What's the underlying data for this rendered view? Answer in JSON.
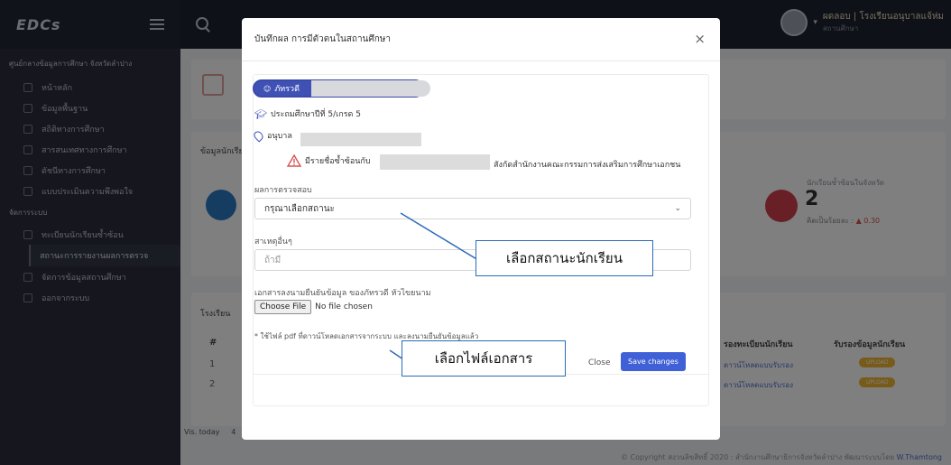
{
  "topbar": {
    "brand": "EDCs",
    "user_name": "ผดลอบ | โรงเรียนอนุบาลแจ้ห่ม",
    "user_role": "สถานศึกษา"
  },
  "sidebar": {
    "org": "ศูนย์กลางข้อมูลการศึกษา จังหวัดลำปาง",
    "items": [
      {
        "label": "หน้าหลัก"
      },
      {
        "label": "ข้อมูลพื้นฐาน"
      },
      {
        "label": "สถิติทางการศึกษา"
      },
      {
        "label": "สารสนเทศทางการศึกษา"
      },
      {
        "label": "ดัชนีทางการศึกษา"
      },
      {
        "label": "แบบประเมินความพึงพอใจ"
      }
    ],
    "section": "จัดการระบบ",
    "items2": [
      {
        "label": "ทะเบียนนักเรียนซ้ำซ้อน"
      }
    ],
    "subitem": "สถานะการรายงานผลการตรวจ",
    "items3": [
      {
        "label": "จัดการข้อมูลสถานศึกษา"
      },
      {
        "label": "ออกจากระบบ"
      }
    ]
  },
  "dashboard": {
    "card_label": "ข้อมูลนักเรียน",
    "stat_label": "นักเรียนซ้ำซ้อนในจังหวัด",
    "stat_value": "2",
    "stat_pct_label": "คิดเป็นร้อยละ :",
    "stat_pct_value": "▲ 0.30",
    "table_label": "โรงเรียน",
    "col_hash": "#",
    "col_reg": "รองทะเบียนนักเรียน",
    "col_cert": "รับรองข้อมูลนักเรียน",
    "rows": [
      {
        "n": "1",
        "link": "ดาวน์โหลดแบบรับรอง",
        "btn": "UPLOAD"
      },
      {
        "n": "2",
        "link": "ดาวน์โหลดแบบรับรอง",
        "btn": "UPLOAD"
      }
    ],
    "footer_left_label": "Vis. today",
    "footer_left_value": "4",
    "footer_right": "© Copyright สงวนลิขสิทธิ์ 2020 : สำนักงานศึกษาธิการจังหวัดลำปาง พัฒนาระบบโดย",
    "footer_right_link": "W.Thamtong"
  },
  "modal": {
    "title": "บันทึกผล การมีตัวตนในสถานศึกษา",
    "close_glyph": "×",
    "student_prefix": "ภัทรวดี",
    "grade": "ประถมศึกษาปีที่ 5/เกรด 5",
    "school_prefix": "อนุบาล",
    "warning_prefix": "มีรายชื่อซ้ำซ้อนกับ",
    "warning_suffix": "สังกัดสำนักงานคณะกรรมการส่งเสริมการศึกษาเอกชน",
    "result_label": "ผลการตรวจสอบ",
    "result_placeholder": "กรุณาเลือกสถานะ",
    "reason_label": "สาเหตุอื่นๆ",
    "reason_placeholder": "ถ้ามี",
    "file_label": "เอกสารลงนามยืนยันข้อมูล ของภัทรวดี หัวไขยนาม",
    "file_button": "Choose File",
    "file_status": "No file chosen",
    "note": "* ใช้ไฟล์ pdf ที่ดาวน์โหลดเอกสารจากระบบ และลงนามยืนยันข้อมูลแล้ว",
    "close_button": "Close",
    "save_button": "Save changes"
  },
  "callouts": {
    "status": "เลือกสถานะนักเรียน",
    "file": "เลือกไฟล์เอกสาร"
  },
  "colors": {
    "accent": "#3f51b5",
    "save": "#3f60d6",
    "callout_border": "#2a6bb8",
    "warning": "#d9534f",
    "upload_badge": "#f0b732"
  }
}
